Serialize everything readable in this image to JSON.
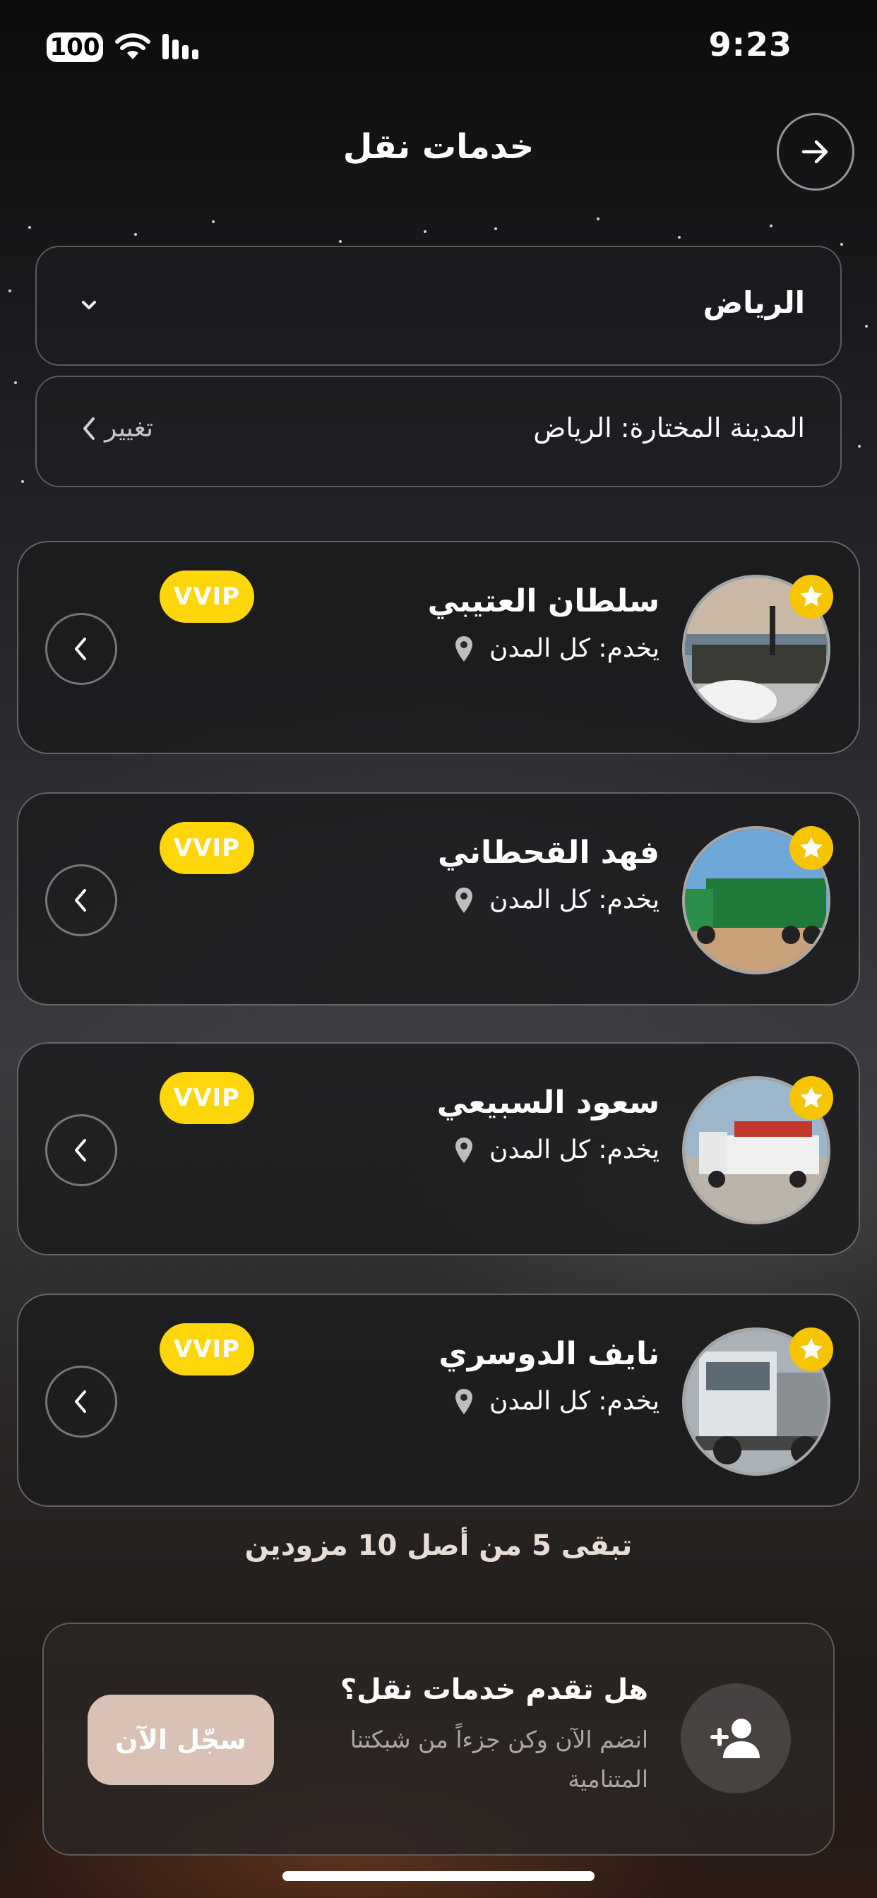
{
  "status_bar": {
    "battery": "100",
    "time": "9:23"
  },
  "header": {
    "title": "خدمات نقل"
  },
  "city_select": {
    "value": "الرياض"
  },
  "selected_city": {
    "label": "المدينة المختارة: الرياض",
    "change_label": "تغيير"
  },
  "providers": [
    {
      "name": "سلطان العتيبي",
      "serves": "يخدم: كل المدن",
      "badge": "VVIP"
    },
    {
      "name": "فهد القحطاني",
      "serves": "يخدم: كل المدن",
      "badge": "VVIP"
    },
    {
      "name": "سعود السبيعي",
      "serves": "يخدم: كل المدن",
      "badge": "VVIP"
    },
    {
      "name": "نايف الدوسري",
      "serves": "يخدم: كل المدن",
      "badge": "VVIP"
    }
  ],
  "remaining_text": "تبقى 5 من أصل 10 مزودين",
  "cta": {
    "title": "هل تقدم خدمات نقل؟",
    "subtitle": "انضم الآن وكن جزءاً من شبكتنا المتنامية",
    "button": "سجّل الآن"
  },
  "colors": {
    "vvip": "#ffd60a",
    "star": "#f7c500",
    "cta_button": "#d9c1b5"
  },
  "icons": [
    "battery-icon",
    "wifi-icon",
    "signal-icon",
    "arrow-right-icon",
    "chevron-down-icon",
    "chevron-left-icon",
    "star-icon",
    "location-pin-icon",
    "add-user-icon"
  ]
}
